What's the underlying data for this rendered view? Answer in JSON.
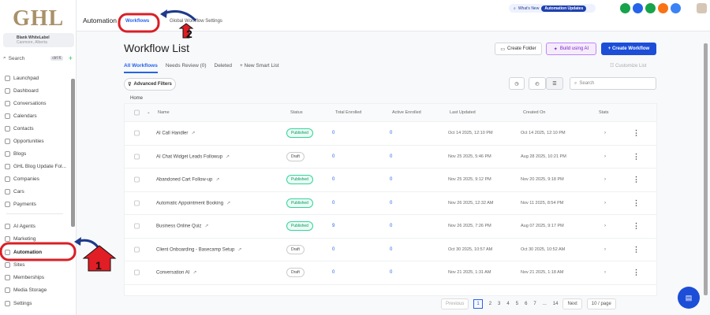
{
  "brand": {
    "logo": "GHL"
  },
  "account": {
    "name": "Blank WhiteLabel",
    "location": "Canmore, Alberta"
  },
  "sidebar": {
    "search_placeholder": "Search",
    "shortcut": "ctrl K",
    "items": [
      {
        "label": "Launchpad",
        "icon": "rocket-icon"
      },
      {
        "label": "Dashboard",
        "icon": "dashboard-icon"
      },
      {
        "label": "Conversations",
        "icon": "chat-icon"
      },
      {
        "label": "Calendars",
        "icon": "calendar-icon"
      },
      {
        "label": "Contacts",
        "icon": "contacts-icon"
      },
      {
        "label": "Opportunities",
        "icon": "opportunities-icon"
      },
      {
        "label": "Blogs",
        "icon": "blog-icon"
      },
      {
        "label": "GHL Blog Update Fol...",
        "icon": "folder-icon"
      },
      {
        "label": "Companies",
        "icon": "building-icon"
      },
      {
        "label": "Cars",
        "icon": "car-icon"
      },
      {
        "label": "Payments",
        "icon": "payments-icon"
      },
      {
        "label": "AI Agents",
        "icon": "sparkle-icon"
      },
      {
        "label": "Marketing",
        "icon": "marketing-icon"
      },
      {
        "label": "Automation",
        "icon": "automation-icon",
        "active": true
      },
      {
        "label": "Sites",
        "icon": "sites-icon"
      },
      {
        "label": "Memberships",
        "icon": "membership-icon"
      },
      {
        "label": "Media Storage",
        "icon": "media-icon"
      },
      {
        "label": "Settings",
        "icon": "gear-icon"
      }
    ]
  },
  "header": {
    "title": "Automation",
    "tabs": [
      "Workflows",
      "Global Workflow Settings"
    ],
    "whats_new": "What's New",
    "badge": "Automation Updates",
    "icons": [
      {
        "name": "phone-icon",
        "color": "#16a34a"
      },
      {
        "name": "link-icon",
        "color": "#2563eb"
      },
      {
        "name": "megaphone-icon",
        "color": "#16a34a"
      },
      {
        "name": "bell-icon",
        "color": "#f97316"
      },
      {
        "name": "help-icon",
        "color": "#3b82f6"
      }
    ]
  },
  "main": {
    "title": "Workflow List",
    "create_folder": "Create Folder",
    "build_ai": "Build using AI",
    "create_workflow": "+ Create Workflow",
    "customize": "Customize List",
    "tabs": [
      "All Workflows",
      "Needs Review (0)",
      "Deleted"
    ],
    "new_smart_list": "+ New Smart List",
    "advanced_filters": "Advanced Filters",
    "search_placeholder": "Search",
    "breadcrumb": "Home",
    "columns": [
      "Name",
      "Status",
      "Total Enrolled",
      "Active Enrolled",
      "Last Updated",
      "Created On",
      "Stats"
    ],
    "rows": [
      {
        "name": "AI Call Handler",
        "status": "Published",
        "total": "0",
        "active": "0",
        "updated": "Oct 14 2025, 12:10 PM",
        "created": "Oct 14 2025, 12:10 PM"
      },
      {
        "name": "AI Chat Widget Leads Followup",
        "status": "Draft",
        "total": "0",
        "active": "0",
        "updated": "Nov 25 2025, 5:46 PM",
        "created": "Aug 28 2025, 10:21 PM"
      },
      {
        "name": "Abandoned Cart Follow-up",
        "status": "Published",
        "total": "0",
        "active": "0",
        "updated": "Nov 25 2025, 9:12 PM",
        "created": "Nov 20 2025, 9:18 PM"
      },
      {
        "name": "Automatic Appointment Booking",
        "status": "Published",
        "total": "0",
        "active": "0",
        "updated": "Nov 26 2025, 12:32 AM",
        "created": "Nov 11 2025, 8:54 PM"
      },
      {
        "name": "Business Online Quiz",
        "status": "Published",
        "total": "9",
        "active": "0",
        "updated": "Nov 26 2025, 7:26 PM",
        "created": "Aug 07 2025, 9:17 PM"
      },
      {
        "name": "Client Onboarding - Basecamp Setup",
        "status": "Draft",
        "total": "0",
        "active": "0",
        "updated": "Oct 30 2025, 10:57 AM",
        "created": "Oct 30 2025, 10:52 AM"
      },
      {
        "name": "Conversation AI",
        "status": "Draft",
        "total": "0",
        "active": "0",
        "updated": "Nov 21 2025, 1:31 AM",
        "created": "Nov 21 2025, 1:18 AM"
      }
    ],
    "pagination": {
      "previous": "Previous",
      "pages": [
        "1",
        "2",
        "3",
        "4",
        "5",
        "6",
        "7",
        "...",
        "14"
      ],
      "current": "1",
      "next": "Next",
      "per_page": "10 / page"
    }
  },
  "annotations": [
    "1",
    "2"
  ]
}
